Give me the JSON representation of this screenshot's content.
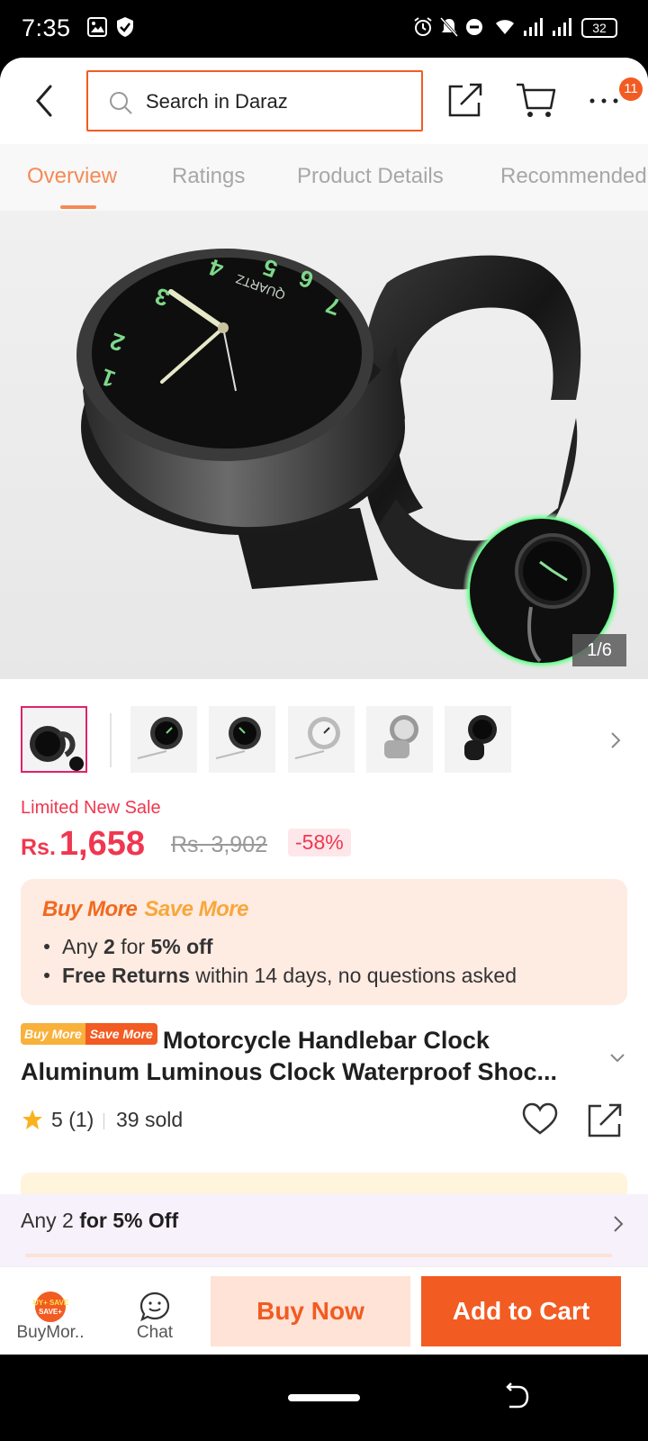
{
  "status_bar": {
    "time": "7:35",
    "battery": "32"
  },
  "header": {
    "search_placeholder": "Search in Daraz",
    "cart_badge": "11"
  },
  "tabs": [
    {
      "label": "Overview",
      "active": true
    },
    {
      "label": "Ratings"
    },
    {
      "label": "Product Details"
    },
    {
      "label": "Recommended"
    }
  ],
  "gallery": {
    "counter": "1/6",
    "clock_numbers": [
      "QUARTZ"
    ]
  },
  "price": {
    "sale_label": "Limited New Sale",
    "currency": "Rs.",
    "amount": "1,658",
    "original": "Rs. 3,902",
    "discount": "-58%"
  },
  "buy_more": {
    "title_a": "Buy More",
    "title_b": "Save More",
    "line1": {
      "pre": "Any ",
      "b1": "2",
      "mid": " for ",
      "b2": "5% off"
    },
    "line2": {
      "b1": "Free Returns",
      "rest": " within 14 days, no questions asked"
    }
  },
  "product": {
    "tag_a": "Buy More",
    "tag_b": "Save More",
    "title": "Motorcycle Handlebar Clock Aluminum Luminous Clock Waterproof Shoc...",
    "rating": "5",
    "rating_count": "(1)",
    "sold": "39 sold"
  },
  "promo_bar": {
    "pre": "Any 2 ",
    "bold": "for 5% Off"
  },
  "bottom_bar": {
    "buymore_label": "BuyMor..",
    "buymore_icon_text": "BUY+ SAVE+",
    "chat_label": "Chat",
    "buy_now": "Buy Now",
    "add_to_cart": "Add to Cart"
  },
  "colors": {
    "accent": "#f25b22",
    "price": "#f0374f",
    "tab_active": "#f58a55"
  }
}
